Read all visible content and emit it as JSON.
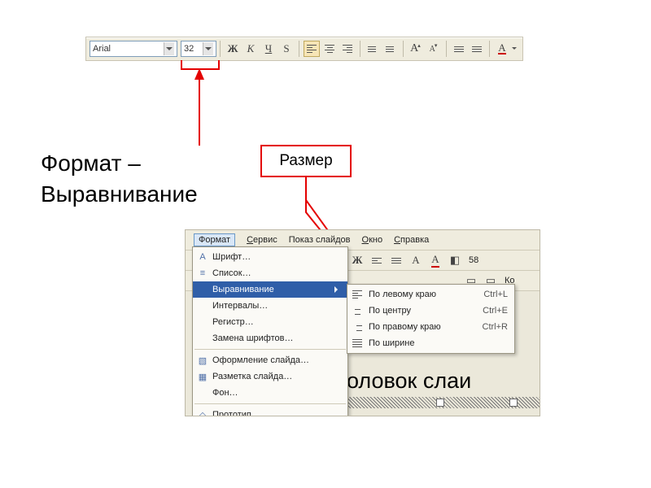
{
  "heading": {
    "line1": "Формат –",
    "line2": "Выравнивание"
  },
  "callout_label": "Размер",
  "toolbar": {
    "font_name": "Arial",
    "font_size": "32",
    "bold": "Ж",
    "italic": "К",
    "underline": "Ч",
    "shadow": "S",
    "sup_A_big": "A",
    "sup_A_small": "A",
    "text_color_A": "A"
  },
  "menubar": {
    "format": "Формат",
    "service": "Сервис",
    "slideshow": "Показ слайдов",
    "window": "Окно",
    "help": "Справка"
  },
  "menu_items": {
    "font": "Шрифт…",
    "list": "Список…",
    "align": "Выравнивание",
    "intervals": "Интервалы…",
    "case": "Регистр…",
    "replace_fonts": "Замена шрифтов…",
    "slide_design": "Оформление слайда…",
    "slide_layout": "Разметка слайда…",
    "background": "Фон…",
    "placeholder": "Прототип…"
  },
  "submenu_items": [
    {
      "label": "По левому краю",
      "shortcut": "Ctrl+L"
    },
    {
      "label": "По центру",
      "shortcut": "Ctrl+E"
    },
    {
      "label": "По правому краю",
      "shortcut": "Ctrl+R"
    },
    {
      "label": "По ширине",
      "shortcut": ""
    }
  ],
  "toolbar2": {
    "percent": "58"
  },
  "toolbar3": {
    "new_slide_fragment": "Ко"
  },
  "bg_text": "оловок слаи"
}
